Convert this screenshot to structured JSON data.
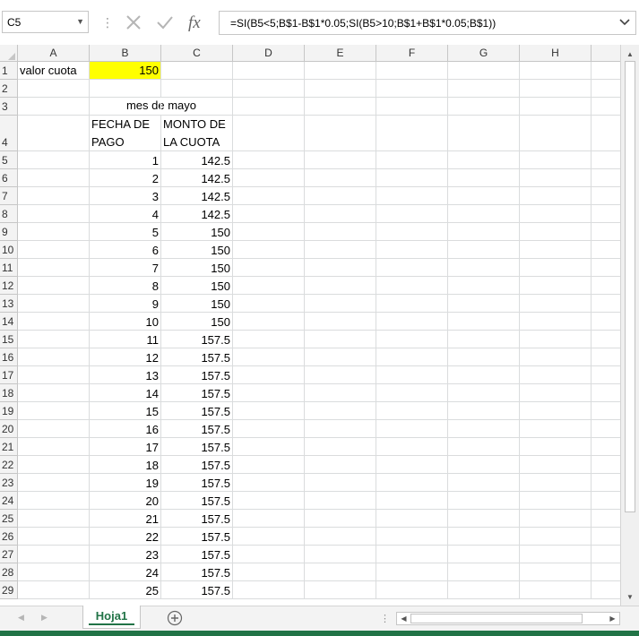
{
  "formula_bar": {
    "name_box": "C5",
    "formula": "=SI(B5<5;B$1-B$1*0.05;SI(B5>10;B$1+B$1*0.05;B$1))",
    "cancel_icon": "x-icon",
    "enter_icon": "check-icon",
    "function_icon": "fx-icon"
  },
  "columns": [
    "A",
    "B",
    "C",
    "D",
    "E",
    "F",
    "G",
    "H"
  ],
  "row_numbers": [
    "1",
    "2",
    "3",
    "4",
    "5",
    "6",
    "7",
    "8",
    "9",
    "10",
    "11",
    "12",
    "13",
    "14",
    "15",
    "16",
    "17",
    "18",
    "19",
    "20",
    "21",
    "22",
    "23",
    "24",
    "25",
    "26",
    "27",
    "28",
    "29"
  ],
  "cells": {
    "A1": "valor cuota",
    "B1": "150",
    "B3_merged": "mes de mayo",
    "B4_line1": "FECHA DE",
    "B4_line2": "PAGO",
    "C4_line1": "MONTO DE",
    "C4_line2": "LA CUOTA"
  },
  "data_rows": [
    {
      "b": "1",
      "c": "142.5"
    },
    {
      "b": "2",
      "c": "142.5"
    },
    {
      "b": "3",
      "c": "142.5"
    },
    {
      "b": "4",
      "c": "142.5"
    },
    {
      "b": "5",
      "c": "150"
    },
    {
      "b": "6",
      "c": "150"
    },
    {
      "b": "7",
      "c": "150"
    },
    {
      "b": "8",
      "c": "150"
    },
    {
      "b": "9",
      "c": "150"
    },
    {
      "b": "10",
      "c": "150"
    },
    {
      "b": "11",
      "c": "157.5"
    },
    {
      "b": "12",
      "c": "157.5"
    },
    {
      "b": "13",
      "c": "157.5"
    },
    {
      "b": "14",
      "c": "157.5"
    },
    {
      "b": "15",
      "c": "157.5"
    },
    {
      "b": "16",
      "c": "157.5"
    },
    {
      "b": "17",
      "c": "157.5"
    },
    {
      "b": "18",
      "c": "157.5"
    },
    {
      "b": "19",
      "c": "157.5"
    },
    {
      "b": "20",
      "c": "157.5"
    },
    {
      "b": "21",
      "c": "157.5"
    },
    {
      "b": "22",
      "c": "157.5"
    },
    {
      "b": "23",
      "c": "157.5"
    },
    {
      "b": "24",
      "c": "157.5"
    },
    {
      "b": "25",
      "c": "157.5"
    }
  ],
  "sheet_tabs": [
    {
      "label": "Hoja1",
      "active": true
    }
  ],
  "colors": {
    "highlight": "#ffff00",
    "accent": "#217346"
  }
}
